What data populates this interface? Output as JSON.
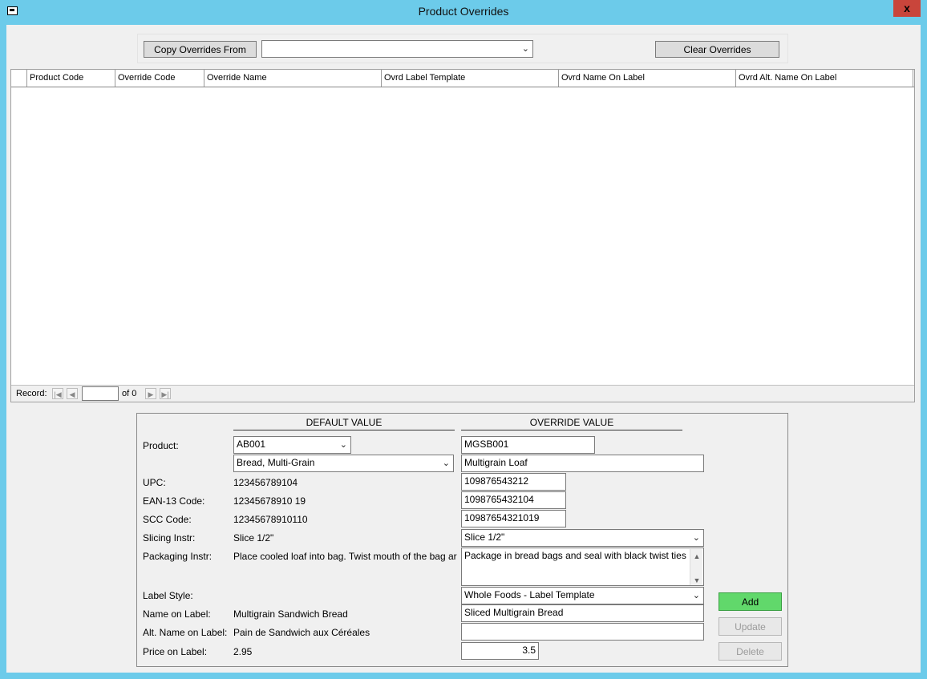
{
  "window": {
    "title": "Product Overrides",
    "close_glyph": "x"
  },
  "toolbar": {
    "copy_button": "Copy Overrides From",
    "copy_from_value": "",
    "clear_button": "Clear Overrides"
  },
  "grid": {
    "columns": [
      "Product Code",
      "Override Code",
      "Override Name",
      "Ovrd Label Template",
      "Ovrd Name On Label",
      "Ovrd Alt. Name On Label"
    ],
    "rows": []
  },
  "navigator": {
    "record_label": "Record:",
    "current": "",
    "of_text": "of 0"
  },
  "detail": {
    "default_header": "DEFAULT VALUE",
    "override_header": "OVERRIDE VALUE",
    "labels": {
      "product": "Product:",
      "upc": "UPC:",
      "ean": "EAN-13 Code:",
      "scc": "SCC Code:",
      "slicing": "Slicing Instr:",
      "packaging": "Packaging Instr:",
      "label_style": "Label Style:",
      "name_on_label": "Name on Label:",
      "alt_name": "Alt. Name on Label:",
      "price": "Price on Label:"
    },
    "defaults": {
      "product_code": "AB001",
      "product_name": "Bread, Multi-Grain",
      "upc": "123456789104",
      "ean": "12345678910 19",
      "scc": "12345678910110",
      "slicing": "Slice 1/2\"",
      "packaging": "Place cooled loaf into bag. Twist mouth of the bag ar",
      "name_on_label": "Multigrain Sandwich Bread",
      "alt_name": "Pain de Sandwich aux Céréales",
      "price": "2.95"
    },
    "overrides": {
      "code": "MGSB001",
      "name": "Multigrain Loaf",
      "upc": "109876543212",
      "ean": "1098765432104",
      "scc": "10987654321019",
      "slicing": "Slice 1/2\"",
      "packaging": "Package in bread bags and seal with black twist ties",
      "label_style": "Whole Foods - Label Template",
      "name_on_label": "Sliced Multigrain Bread",
      "alt_name": "",
      "price": "3.5"
    },
    "buttons": {
      "add": "Add",
      "update": "Update",
      "delete": "Delete"
    }
  },
  "colors": {
    "frame": "#6ccbea",
    "close": "#c9453b",
    "add_button": "#61d86b"
  }
}
